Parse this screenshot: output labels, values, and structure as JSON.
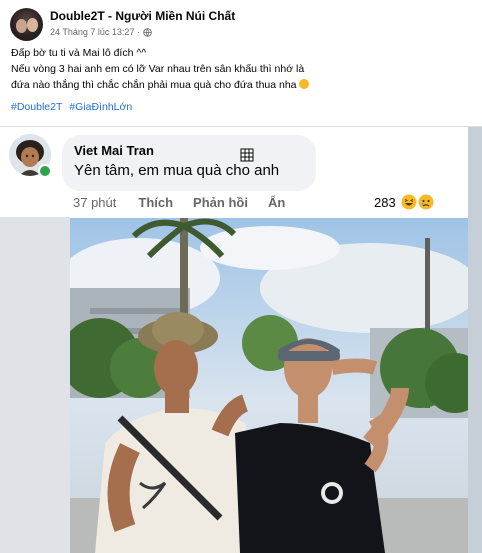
{
  "post": {
    "page_name": "Double2T - Người Miền Núi Chất",
    "timestamp": "24 Tháng 7 lúc 13:27 ·",
    "privacy_icon": "globe-icon",
    "caption_lines": [
      "Đấp bờ tu ti và Mai lô đích ^^",
      "Nếu vòng 3 hai anh em có lỡ Var nhau trên sân khấu thì nhớ là",
      "đứa nào thắng thì chắc chắn phải mua quà cho đứa thua nha"
    ],
    "caption_emoji": "laughing-emoji",
    "hashtags": [
      "#Double2T",
      "#GiaĐìnhLớn"
    ]
  },
  "comment": {
    "author": "Viet Mai Tran",
    "text": "Yên tâm, em mua quà cho anh",
    "time": "37 phút",
    "actions": [
      "Thích",
      "Phản hồi",
      "Ẩn"
    ],
    "reaction_count": "283",
    "reaction_icons": [
      "haha-icon",
      "sad-icon"
    ],
    "online": true
  },
  "colors": {
    "hashtag": "#216fdb",
    "secondary_text": "#65676b",
    "bubble": "#f0f2f5",
    "online": "#31a24c"
  }
}
